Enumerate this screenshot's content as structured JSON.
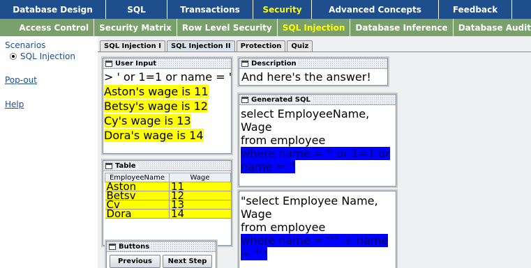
{
  "top_nav": [
    {
      "label": "Database Design",
      "width": 0,
      "active": false
    },
    {
      "label": "SQL",
      "active": false
    },
    {
      "label": "Transactions",
      "active": false
    },
    {
      "label": "Security",
      "active": true
    },
    {
      "label": "Advanced Concepts",
      "active": false
    },
    {
      "label": "Feedback",
      "active": false
    }
  ],
  "sub_nav": [
    {
      "label": "Access Control",
      "active": false
    },
    {
      "label": "Security Matrix",
      "active": false
    },
    {
      "label": "Row Level Security",
      "active": false
    },
    {
      "label": "SQL Injection",
      "active": true
    },
    {
      "label": "Database Inference",
      "active": false
    },
    {
      "label": "Database Audit",
      "active": false
    }
  ],
  "sidebar": {
    "heading": "Scenarios",
    "scenario": "SQL Injection",
    "popout": "Pop-out",
    "help": "Help"
  },
  "tabs": [
    {
      "label": "SQL Injection I",
      "active": false
    },
    {
      "label": "SQL Injection II",
      "active": true
    },
    {
      "label": "Protection",
      "active": false
    },
    {
      "label": "Quiz",
      "active": false
    }
  ],
  "user_input": {
    "title": "User Input",
    "prompt": "> ' or 1=1 or name = '",
    "results": [
      "Aston's wage is 11",
      "Betsy's wage is 12",
      "Cy's wage is 13",
      "Dora's wage is 14"
    ]
  },
  "table": {
    "title": "Table",
    "columns": [
      "EmployeeName",
      "Wage"
    ],
    "rows": [
      [
        "Aston",
        "11"
      ],
      [
        "Betsv",
        "12"
      ],
      [
        "Cv",
        "13"
      ],
      [
        "Dora",
        "14"
      ]
    ]
  },
  "description": {
    "title": "Description",
    "text": "And here's the answer!"
  },
  "generated_sql": {
    "title": "Generated SQL",
    "line1": "select EmployeeName, Wage",
    "line2": "from employee",
    "line3": "where name = '' or 1=1 or",
    "line4": "name = ''"
  },
  "code": {
    "line1": "\"select Employee Name, Wage",
    "line2": "from employee",
    "line3": "where name = '\"\" + name + \"'\""
  },
  "buttons": {
    "title": "Buttons",
    "previous": "Previous",
    "next": "Next Step"
  },
  "colors": {
    "nav_bg": "#1f4e8c",
    "subnav_bg": "#7aa06b",
    "active_text": "#ffff00",
    "highlight_yellow": "#ffff00",
    "highlight_blue": "#0000ff"
  }
}
